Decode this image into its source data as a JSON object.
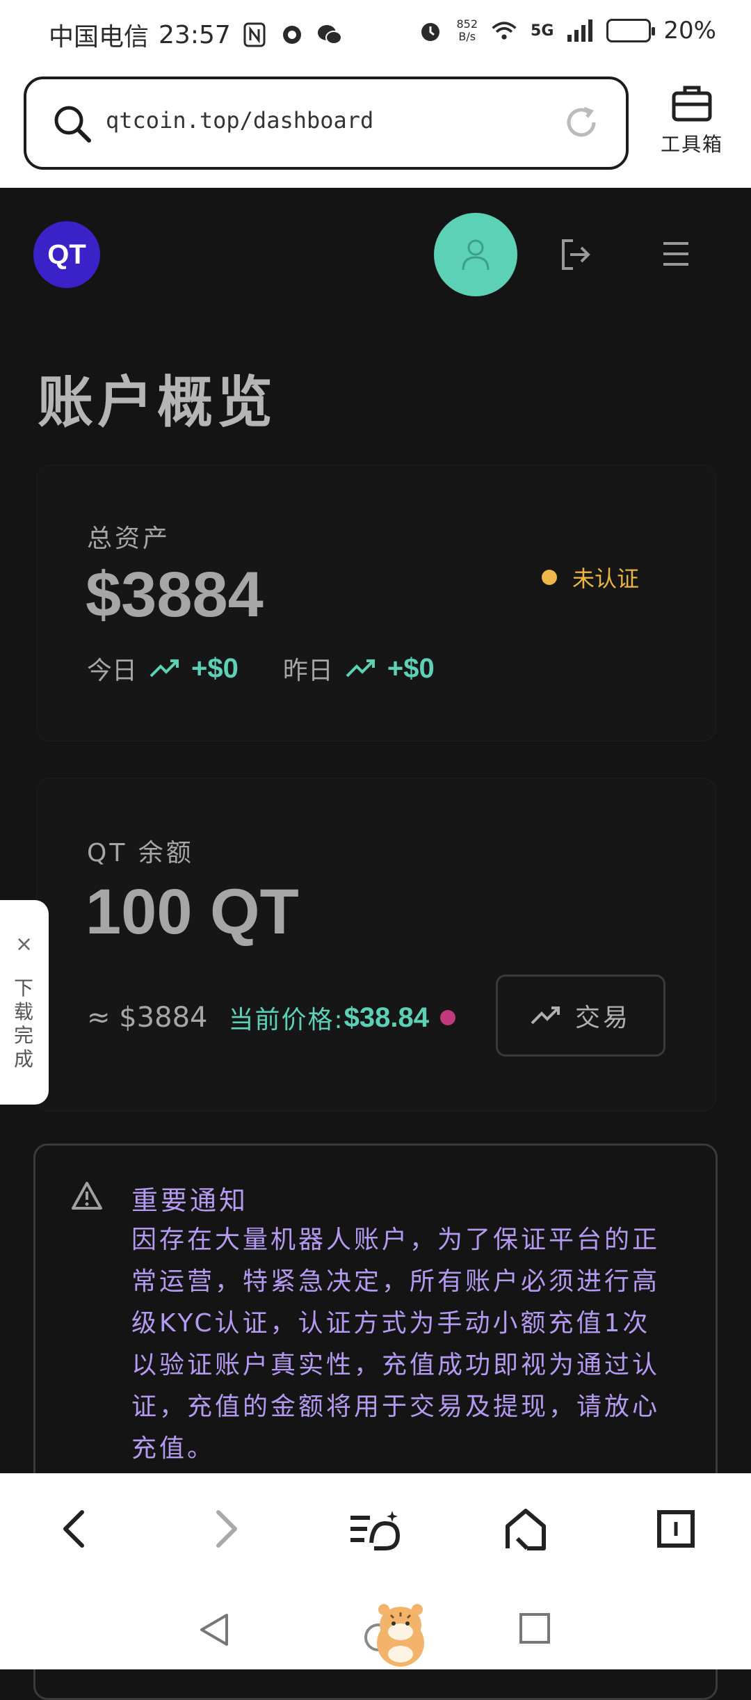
{
  "status_bar": {
    "carrier": "中国电信",
    "time": "23:57",
    "net_speed_value": "852",
    "net_speed_unit": "B/s",
    "signal_type": "5G",
    "battery": "20%"
  },
  "browser": {
    "url": "qtcoin.top/dashboard",
    "toolbox_label": "工具箱"
  },
  "app": {
    "logo_text": "QT",
    "page_title": "账户概览"
  },
  "total_assets": {
    "label": "总资产",
    "value": "$3884",
    "status_text": "未认证",
    "today_label": "今日",
    "today_value": "+$0",
    "yesterday_label": "昨日",
    "yesterday_value": "+$0"
  },
  "qt_balance": {
    "label": "QT 余额",
    "value": "100 QT",
    "approx": "≈ $3884",
    "price_label": "当前价格:",
    "price_value": "$38.84",
    "trade_label": "交易"
  },
  "notice": {
    "title": "重要通知",
    "body": "因存在大量机器人账户，为了保证平台的正常运营，特紧急决定，所有账户必须进行高级KYC认证，认证方式为手动小额充值1次以验证账户真实性，充值成功即视为通过认证，充值的金额将用于交易及提现，请放心充值。"
  },
  "download_tab": {
    "close": "×",
    "text": "下载完成"
  },
  "colors": {
    "accent_teal": "#5cd1b6",
    "logo_purple": "#3a22c8",
    "warning_yellow": "#f0b84a",
    "notice_purple": "#b49af0",
    "price_dot": "#c23a7d"
  }
}
